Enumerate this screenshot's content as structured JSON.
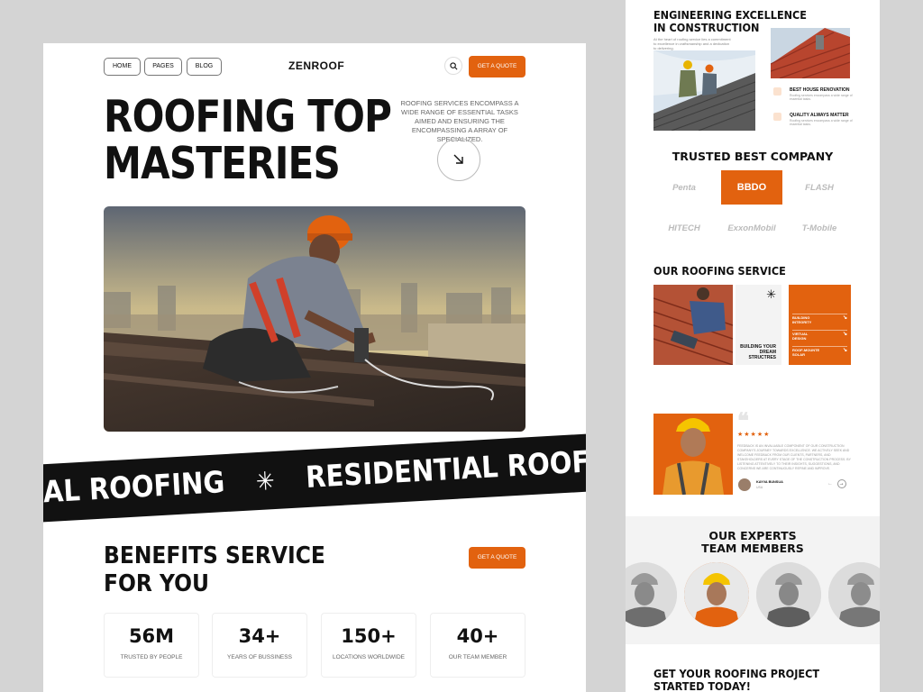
{
  "left": {
    "nav": {
      "home": "HOME",
      "pages": "PAGES",
      "blog": "BLOG",
      "brand": "ZENROOF",
      "quote": "GET A QUOTE"
    },
    "hero": {
      "title_line1": "ROOFING TOP",
      "title_line2": "MASTERIES",
      "description": "ROOFING SERVICES ENCOMPASS A WIDE RANGE OF ESSENTIAL TASKS AIMED AND ENSURING THE ENCOMPASSING A ARRAY OF SPECIALIZED."
    },
    "marquee": {
      "item1": "RCIAL ROOFING",
      "star": "✳",
      "item2": "RESIDENTIAL ROOF"
    },
    "benefits": {
      "title_line1": "BENEFITS SERVICE",
      "title_line2": "FOR YOU",
      "quote": "GET A QUOTE",
      "stats": [
        {
          "num": "56M",
          "label": "TRUSTED BY PEOPLE"
        },
        {
          "num": "34+",
          "label": "YEARS OF BUSSINESS"
        },
        {
          "num": "150+",
          "label": "LOCATIONS WORLDWIDE"
        },
        {
          "num": "40+",
          "label": "OUR TEAM MEMBER"
        }
      ]
    }
  },
  "right": {
    "engineering": {
      "title_line1": "ENGINEERING EXCELLENCE",
      "title_line2": "IN CONSTRUCTION",
      "desc": "At the heart of roofing service lies a commitment to excellence in craftsmanship and a dedication to delivering.",
      "features": [
        {
          "title": "BEST HOUSE RENOVATION",
          "desc": "Roofing services encompass a wide range of essential tasks."
        },
        {
          "title": "QUALITY ALWAYS MATTER",
          "desc": "Roofing services encompass a wide range of essential tasks."
        }
      ]
    },
    "trusted": {
      "title": "TRUSTED BEST COMPANY",
      "logos": [
        "Penta",
        "BBDO",
        "FLASH",
        "HITECH",
        "ExxonMobil",
        "T-Mobile"
      ]
    },
    "service": {
      "title": "OUR ROOFING SERVICE",
      "mid_text": "BUILDING YOUR DREAM STRUCTRES",
      "items": [
        "BUILDING INTEGRITY",
        "VIRTUAL DESIGN",
        "ROOF-MOUNTE SOLAR"
      ]
    },
    "testimonial": {
      "quote_mark": "❝",
      "stars": "★★★★★",
      "text": "FEEDBACK IS AN INVALUABLE COMPONENT OF OUR CONSTRUCTION COMPANY'S JOURNEY TOWARDS EXCELLENCE. WE ACTIVELY SEEK AND WELCOME FEEDBACK FROM OUR CLIENTS, PARTNERS, AND STAKEHOLDERS AT EVERY STAGE OF THE CONSTRUCTION PROCESS. BY LISTENING ATTENTIVELY TO THEIR INSIGHTS, SUGGESTIONS, AND CONCERNS WE ARE CONTINUOUSLY REFINE AND IMPROVE.",
      "author": "KAYVA BUNSUA",
      "role": "USA"
    },
    "experts": {
      "title_line1": "OUR EXPERTS",
      "title_line2": "TEAM MEMBERS"
    },
    "cta": {
      "title_line1": "GET YOUR ROOFING PROJECT",
      "title_line2": "STARTED TODAY!"
    }
  },
  "colors": {
    "accent": "#e2620f",
    "dark": "#111111",
    "background": "#d4d4d4"
  },
  "icons": [
    "search-icon",
    "arrow-down-right-icon",
    "asterisk-icon",
    "quote-icon",
    "star-icon",
    "chevron-right-icon"
  ]
}
